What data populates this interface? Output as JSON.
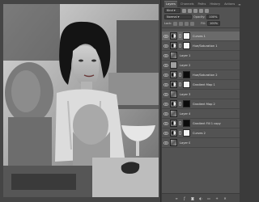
{
  "panel": {
    "tabs": [
      "Layers",
      "Channels",
      "Paths",
      "History",
      "Actions"
    ],
    "active_tab": "Layers",
    "filter_kind": "Kind",
    "blend_mode": "Normal",
    "opacity_label": "Opacity:",
    "opacity_value": "100%",
    "lock_label": "Lock:",
    "fill_label": "Fill:",
    "fill_value": "100%"
  },
  "layers": [
    {
      "name": "Curves 1",
      "thumb": "adj",
      "mask": "white",
      "selected": true
    },
    {
      "name": "Hue/Saturation 1",
      "thumb": "adj",
      "mask": "white",
      "selected": false
    },
    {
      "name": "Layer 1",
      "thumb": "photo",
      "mask": "",
      "selected": false
    },
    {
      "name": "Layer 2",
      "thumb": "gray",
      "mask": "",
      "selected": false
    },
    {
      "name": "Hue/Saturation 2",
      "thumb": "adj",
      "mask": "black",
      "selected": false
    },
    {
      "name": "Gradient Map 1",
      "thumb": "adj",
      "mask": "white",
      "selected": false
    },
    {
      "name": "Layer 3",
      "thumb": "photo",
      "mask": "",
      "selected": false
    },
    {
      "name": "Gradient Map 2",
      "thumb": "adj",
      "mask": "black",
      "selected": false
    },
    {
      "name": "Layer 4",
      "thumb": "photo",
      "mask": "",
      "selected": false
    },
    {
      "name": "Gradient Fill 1 copy",
      "thumb": "adj",
      "mask": "black",
      "selected": false
    },
    {
      "name": "Curves 2",
      "thumb": "adj",
      "mask": "white",
      "selected": false
    },
    {
      "name": "Layer 0",
      "thumb": "photo",
      "mask": "",
      "selected": false
    }
  ],
  "footer_icons": [
    "link-icon",
    "fx-icon",
    "mask-icon",
    "adjustment-icon",
    "folder-icon",
    "new-layer-icon",
    "trash-icon"
  ]
}
